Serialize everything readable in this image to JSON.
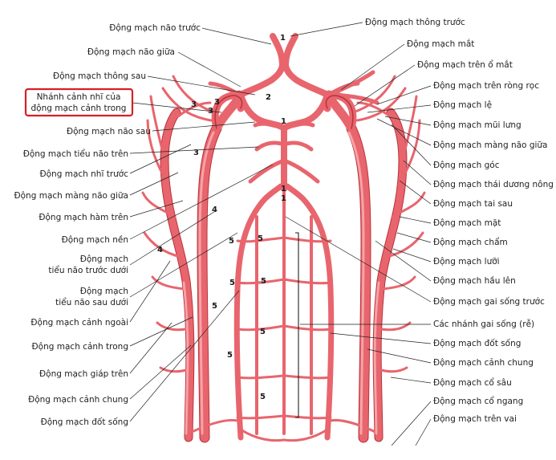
{
  "diagram": {
    "left_labels": [
      "Động mạch não trước",
      "Động mạch não giữa",
      "Động mạch thông sau",
      "Động mạch não sau",
      "Động mạch tiểu não trên",
      "Động mạch nhĩ trước",
      "Động mạch màng não giữa",
      "Động mạch hàm trên",
      "Động mạch nền",
      "Động mạch",
      "tiểu não trước dưới",
      "Động mạch",
      "tiểu não sau dưới",
      "Động mạch cảnh ngoài",
      "Động mạch cảnh trong",
      "Động mạch giáp trên",
      "Động mạch cảnh chung",
      "Động mạch đốt sống"
    ],
    "highlight_label": [
      "Nhánh cảnh nhĩ của",
      "động mạch cảnh trong"
    ],
    "right_labels": [
      "Động mạch thông trước",
      "Động mạch mắt",
      "Động mạch trên ổ mắt",
      "Động mạch trên ròng rọc",
      "Động mạch lệ",
      "Động mạch mũi lưng",
      "Động mạch màng não giữa",
      "Động mạch góc",
      "Động mạch thái dương nông",
      "Động mạch tai sau",
      "Động mạch mặt",
      "Động mạch chẩm",
      "Động mạch lưỡi",
      "Động mạch hầu lên",
      "Động mạch gai sống trước",
      "Các nhánh gai sống (rễ)",
      "Động mạch đốt sống",
      "Động mạch cảnh chung",
      "Động mạch cổ sâu",
      "Động mạch cổ ngang",
      "Động mạch trên vai"
    ],
    "numbers": [
      "1",
      "2",
      "3",
      "3",
      "3",
      "3",
      "1",
      "1",
      "1",
      "4",
      "4",
      "5",
      "5",
      "5",
      "5",
      "5",
      "5",
      "5",
      "5"
    ],
    "colors": {
      "artery": "#e8656d",
      "artery_highlight": "#f6a3a7",
      "artery_edge": "#b8333b",
      "highlight_box": "#d32027"
    }
  }
}
